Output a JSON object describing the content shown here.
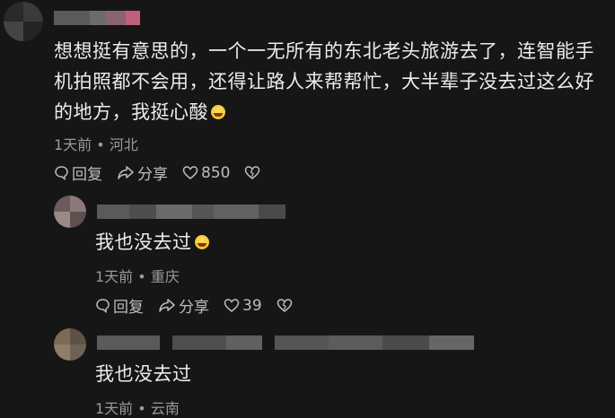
{
  "comments": [
    {
      "text": "想想挺有意思的，一个一无所有的东北老头旅游去了，连智能手机拍照都不会用，还得让路人来帮帮忙，大半辈子没去过这么好的地方，我挺心酸",
      "emoji": "crying-face",
      "time": "1天前",
      "location": "河北",
      "reply_label": "回复",
      "share_label": "分享",
      "likes": "850"
    },
    {
      "text": "我也没去过",
      "emoji": "laughing-tears-face",
      "time": "1天前",
      "location": "重庆",
      "reply_label": "回复",
      "share_label": "分享",
      "likes": "39"
    },
    {
      "text": "我也没去过",
      "time": "1天前",
      "location": "云南"
    }
  ],
  "separator": "•",
  "icons": {
    "reply": "chat-bubble-icon",
    "share": "share-arrow-icon",
    "like": "heart-icon",
    "dislike": "broken-heart-icon"
  },
  "colors": {
    "background": "#161616",
    "text": "#ececec",
    "meta": "#9a9a9a"
  }
}
